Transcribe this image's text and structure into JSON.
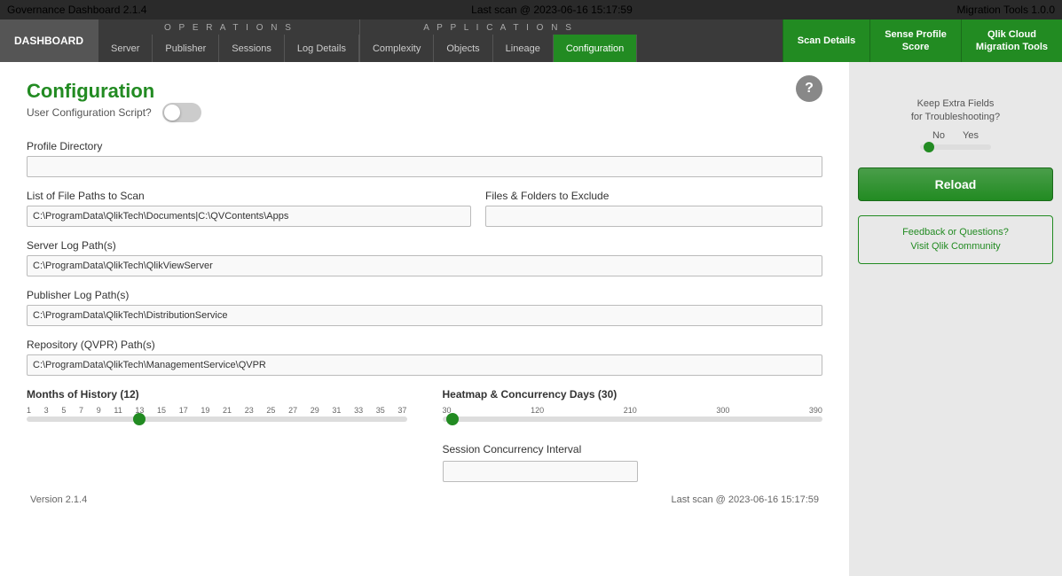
{
  "topbar": {
    "left": "Governance Dashboard 2.1.4",
    "center": "Last scan @ 2023-06-16 15:17:59",
    "right": "Migration Tools 1.0.0"
  },
  "nav": {
    "dashboard_label": "DASHBOARD",
    "operations_title": "O P E R A T I O N S",
    "operations_tabs": [
      "Server",
      "Publisher",
      "Sessions",
      "Log Details"
    ],
    "applications_title": "A P P L I C A T I O N S",
    "applications_tabs": [
      "Complexity",
      "Objects",
      "Lineage"
    ],
    "active_tab": "Configuration",
    "scan_details_label": "Scan Details",
    "right_buttons": [
      {
        "label": "Sense Profile\nScore"
      },
      {
        "label": "Qlik Cloud\nMigration Tools"
      }
    ]
  },
  "page": {
    "title": "Configuration",
    "help_icon": "?",
    "user_config_label": "User Configuration Script?",
    "profile_directory_label": "Profile Directory",
    "profile_directory_value": "",
    "list_paths_label": "List of File Paths to Scan",
    "files_folders_label": "Files & Folders to Exclude",
    "files_folders_value": "",
    "scan_paths_value": "C:\\ProgramData\\QlikTech\\Documents|C:\\QVContents\\Apps",
    "server_log_label": "Server Log Path(s)",
    "server_log_value": "C:\\ProgramData\\QlikTech\\QlikViewServer",
    "publisher_log_label": "Publisher Log Path(s)",
    "publisher_log_value": "C:\\ProgramData\\QlikTech\\DistributionService",
    "repository_label": "Repository (QVPR) Path(s)",
    "repository_value": "C:\\ProgramData\\QlikTech\\ManagementService\\QVPR",
    "months_history_label": "Months of History (12)",
    "months_ticks": [
      "1",
      "3",
      "5",
      "7",
      "9",
      "11",
      "13",
      "15",
      "17",
      "19",
      "21",
      "23",
      "25",
      "27",
      "29",
      "31",
      "33",
      "35",
      "37"
    ],
    "months_thumb_pct": 30,
    "heatmap_label": "Heatmap & Concurrency Days (30)",
    "heatmap_ticks": [
      "30",
      "120",
      "210",
      "300",
      "390"
    ],
    "heatmap_thumb_pct": 2,
    "session_concurrency_label": "Session Concurrency Interval",
    "keep_extra_title": "Keep Extra Fields\nfor Troubleshooting?",
    "no_label": "No",
    "yes_label": "Yes",
    "reload_label": "Reload",
    "feedback_line1": "Feedback or Questions?",
    "feedback_line2": "Visit Qlik Community",
    "version_label": "Version 2.1.4",
    "last_scan_label": "Last scan @ 2023-06-16 15:17:59"
  }
}
